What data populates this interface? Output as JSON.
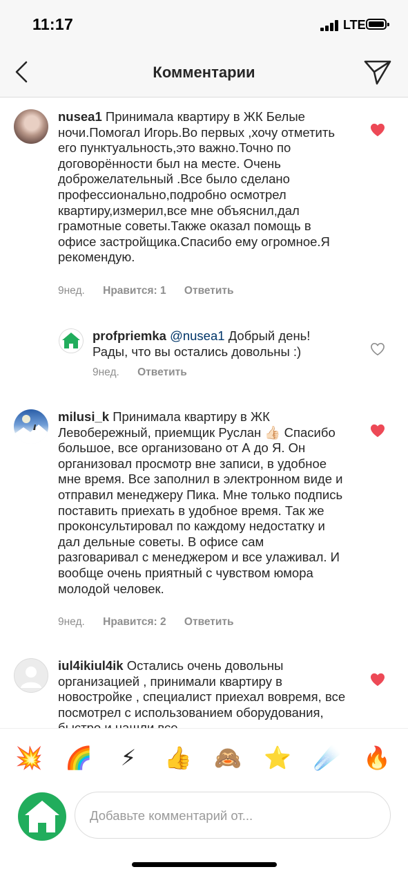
{
  "status_bar": {
    "time": "11:17",
    "network": "LTE"
  },
  "header": {
    "title": "Комментарии",
    "back_icon": "chevron-left-icon",
    "send_icon": "paper-plane-icon"
  },
  "comments": [
    {
      "username": "nusea1",
      "text": "Принимала квартиру в ЖК Белые ночи.Помогал Игорь.Во первых ,хочу отметить его пунктуальность,это важно.Точно по  договорённости был на месте. Очень доброжелательный .Все было сделано профессионально,подробно осмотрел квартиру,измерил,все мне объяснил,дал грамотные советы.Также оказал помощь в офисе застройщика.Спасибо ему огромное.Я рекомендую.",
      "time": "9нед.",
      "likes": "Нравится: 1",
      "reply": "Ответить",
      "liked": true
    },
    {
      "username": "profpriemka",
      "mention": "@nusea1",
      "text": "Добрый день! Рады, что вы остались довольны :)",
      "time": "9нед.",
      "reply": "Ответить",
      "liked": false
    },
    {
      "username": "milusi_k",
      "text_before": "Принимала квартиру в ЖК Левобережный, приемщик Руслан",
      "emoji": "👍🏻",
      "text_after": "Спасибо большое, все организовано от А до Я. Он организовал просмотр вне записи, в удобное мне время. Все заполнил в электронном виде и отправил менеджеру Пика. Мне только подпись поставить приехать в удобное время. Так же проконсультировал по каждому недостатку и дал дельные советы. В офисе сам разговаривал с менеджером и все улаживал.  И вообще очень приятный с чувством юмора молодой человек.",
      "time": "9нед.",
      "likes": "Нравится: 2",
      "reply": "Ответить",
      "liked": true
    },
    {
      "username": "iul4ikiul4ik",
      "text": "Остались очень довольны организацией , принимали квартиру в новостройке , специалист приехал вовремя, все посмотрел с использованием оборудования, быстро и нашли все",
      "liked": true
    }
  ],
  "emoji_bar": [
    {
      "char": "💥",
      "name": "collision-emoji"
    },
    {
      "char": "🌈",
      "name": "rainbow-emoji"
    },
    {
      "char": "⚡",
      "name": "lightning-emoji"
    },
    {
      "char": "👍",
      "name": "thumbs-up-emoji"
    },
    {
      "char": "🙈",
      "name": "see-no-evil-monkey-emoji"
    },
    {
      "char": "⭐",
      "name": "star-emoji"
    },
    {
      "char": "☄️",
      "name": "comet-emoji"
    },
    {
      "char": "🔥",
      "name": "fire-emoji"
    }
  ],
  "composer": {
    "placeholder": "Добавьте комментарий от..."
  },
  "colors": {
    "heart_liked": "#ed4956",
    "brand_green": "#21ad5c",
    "mention": "#003569",
    "meta": "#8e8e8e"
  }
}
